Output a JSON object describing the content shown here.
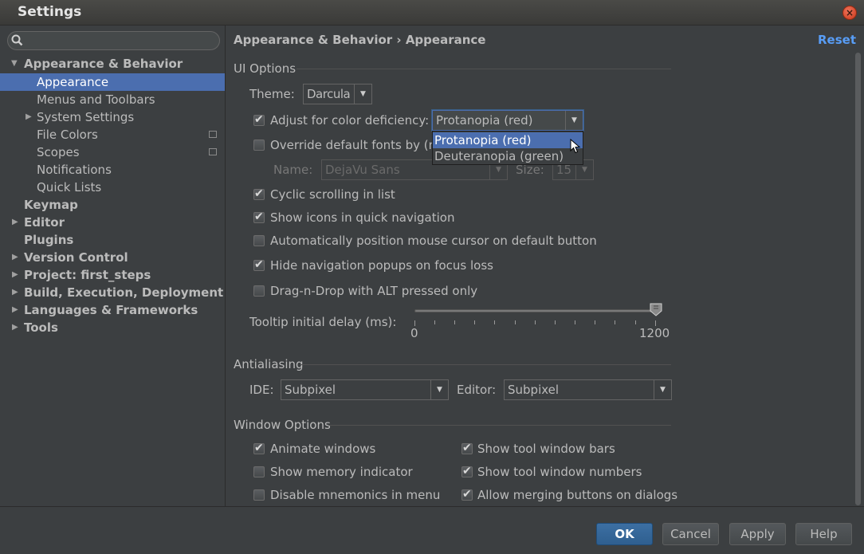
{
  "window": {
    "title": "Settings",
    "close": "×"
  },
  "search": {
    "placeholder": ""
  },
  "sidebar": {
    "items": [
      {
        "label": "Appearance & Behavior",
        "bold": true
      },
      {
        "label": "Appearance",
        "selected": true
      },
      {
        "label": "Menus and Toolbars"
      },
      {
        "label": "System Settings"
      },
      {
        "label": "File Colors"
      },
      {
        "label": "Scopes"
      },
      {
        "label": "Notifications"
      },
      {
        "label": "Quick Lists"
      },
      {
        "label": "Keymap",
        "bold": true
      },
      {
        "label": "Editor",
        "bold": true
      },
      {
        "label": "Plugins",
        "bold": true
      },
      {
        "label": "Version Control",
        "bold": true
      },
      {
        "label": "Project: first_steps",
        "bold": true
      },
      {
        "label": "Build, Execution, Deployment",
        "bold": true
      },
      {
        "label": "Languages & Frameworks",
        "bold": true
      },
      {
        "label": "Tools",
        "bold": true
      }
    ]
  },
  "header": {
    "breadcrumb": "Appearance & Behavior › Appearance",
    "reset": "Reset"
  },
  "ui_options": {
    "title": "UI Options",
    "theme_label": "Theme:",
    "theme_value": "Darcula",
    "color_deficiency_label": "Adjust for color deficiency:",
    "color_deficiency_checked": true,
    "color_deficiency_value": "Protanopia (red)",
    "color_deficiency_options": [
      "Protanopia (red)",
      "Deuteranopia (green)"
    ],
    "override_fonts_label": "Override default fonts by (no",
    "override_fonts_checked": false,
    "name_label": "Name:",
    "name_value": "DejaVu Sans",
    "size_label": "Size:",
    "size_value": "15",
    "cyclic_label": "Cyclic scrolling in list",
    "cyclic_checked": true,
    "show_icons_label": "Show icons in quick navigation",
    "show_icons_checked": true,
    "auto_position_label": "Automatically position mouse cursor on default button",
    "auto_position_checked": false,
    "hide_popups_label": "Hide navigation popups on focus loss",
    "hide_popups_checked": true,
    "drag_drop_label": "Drag-n-Drop with ALT pressed only",
    "drag_drop_checked": false,
    "tooltip_label": "Tooltip initial delay (ms):",
    "tooltip_min": "0",
    "tooltip_max": "1200",
    "tooltip_value": 1200
  },
  "antialiasing": {
    "title": "Antialiasing",
    "ide_label": "IDE:",
    "ide_value": "Subpixel",
    "editor_label": "Editor:",
    "editor_value": "Subpixel"
  },
  "window_options": {
    "title": "Window Options",
    "animate_label": "Animate windows",
    "animate_checked": true,
    "memory_label": "Show memory indicator",
    "memory_checked": false,
    "mnemonics_label": "Disable mnemonics in menu",
    "mnemonics_checked": false,
    "tool_bars_label": "Show tool window bars",
    "tool_bars_checked": true,
    "tool_numbers_label": "Show tool window numbers",
    "tool_numbers_checked": true,
    "merging_label": "Allow merging buttons on dialogs",
    "merging_checked": true
  },
  "footer": {
    "ok": "OK",
    "cancel": "Cancel",
    "apply": "Apply",
    "help": "Help"
  },
  "colors": {
    "accent": "#4b6eaf",
    "link": "#589df6",
    "background": "#3c3f41"
  }
}
